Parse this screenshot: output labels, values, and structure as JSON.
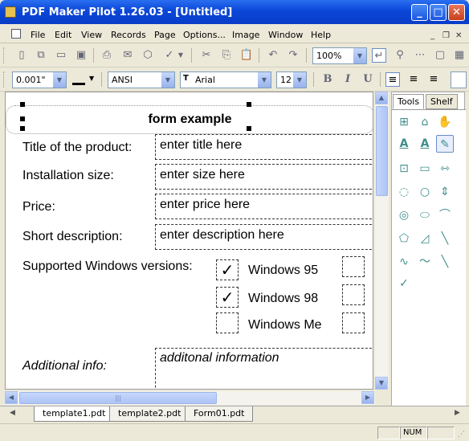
{
  "window": {
    "title": "PDF Maker Pilot 1.26.03 - [Untitled]",
    "min": "_",
    "max": "□",
    "close": "✕"
  },
  "menu": {
    "items": [
      "File",
      "Edit",
      "View",
      "Records",
      "Page",
      "Options...",
      "Image",
      "Window",
      "Help"
    ],
    "mdi_min": "_",
    "mdi_restore": "❐",
    "mdi_close": "✕"
  },
  "toolbar": {
    "zoom": "100%",
    "line_width": "0.001\"",
    "charset": "ANSI",
    "font": "Arial",
    "font_size": "12",
    "bold": "B",
    "italic": "I",
    "underline": "U"
  },
  "form": {
    "title": "form example",
    "labels": [
      "Title of the product:",
      "Installation size:",
      "Price:",
      "Short description:",
      "Supported Windows versions:",
      "Additional info:"
    ],
    "fields": [
      "enter title here",
      "enter size here",
      "enter price here",
      "enter description here",
      "additonal information"
    ],
    "checks": [
      {
        "label": "Windows 95",
        "checked": true
      },
      {
        "label": "Windows 98",
        "checked": true
      },
      {
        "label": "Windows Me",
        "checked": false
      }
    ],
    "check_mark": "✓"
  },
  "panel": {
    "tabs": [
      "Tools",
      "Shelf"
    ]
  },
  "doc_tabs": [
    "template1.pdt",
    "template2.pdt",
    "Form01.pdt"
  ],
  "status": {
    "num": "NUM"
  }
}
